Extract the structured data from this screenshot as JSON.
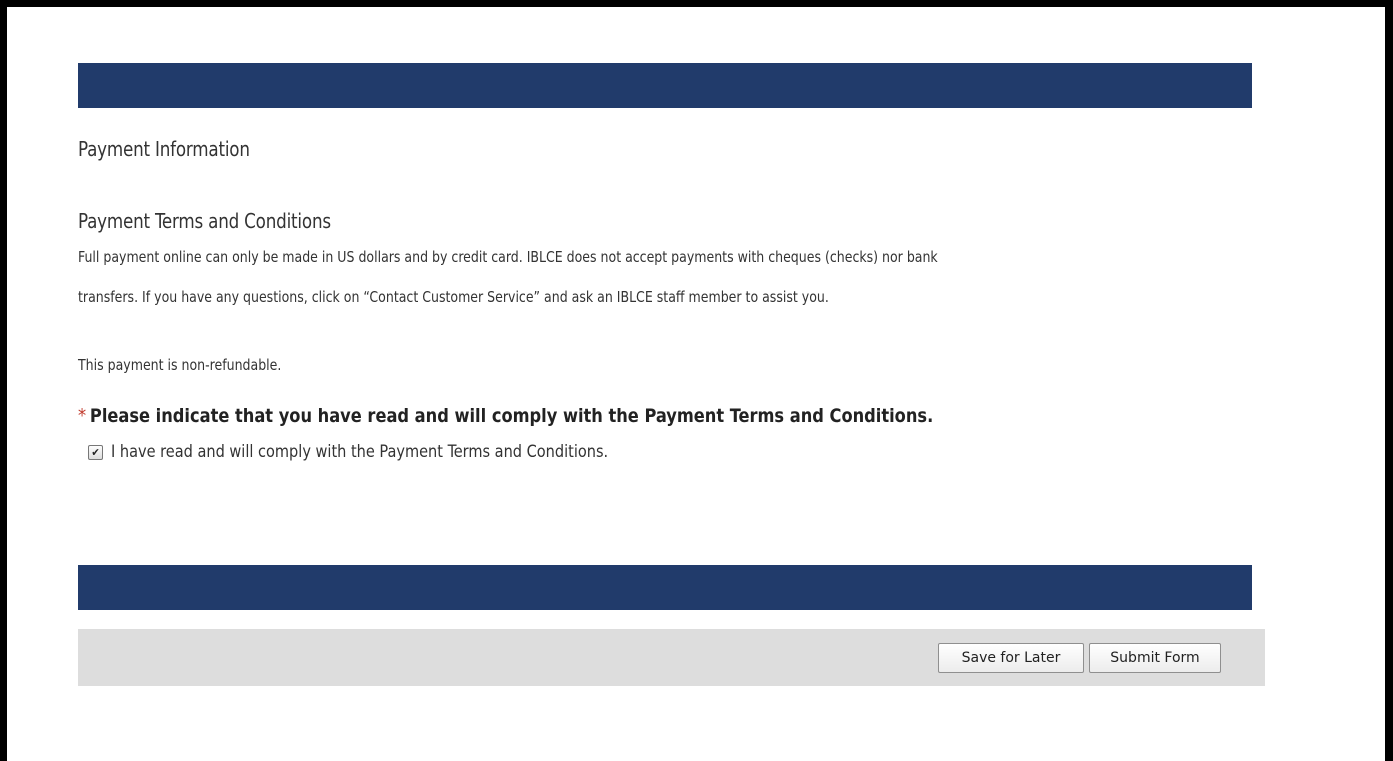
{
  "sections": {
    "payment_information": "Payment Information",
    "terms_title": "Payment Terms and Conditions",
    "terms_line1": "Full payment online can only be made in US dollars and by credit card. IBLCE does not accept payments with cheques (checks) nor bank",
    "terms_line2": "transfers. If you have any questions, click on “Contact Customer Service” and ask an IBLCE staff member to assist you.",
    "non_refundable": "This payment is non-refundable."
  },
  "agreement": {
    "required_marker": "*",
    "question": "Please indicate that you have read and will comply with the Payment Terms and Conditions.",
    "checkbox_label": "I have read and will comply with the Payment Terms and Conditions.",
    "checked": true
  },
  "actions": {
    "save_label": "Save for Later",
    "submit_label": "Submit Form"
  },
  "colors": {
    "header_band": "#213b6b",
    "action_bar": "#dddddd",
    "required_marker": "#c0392b"
  }
}
